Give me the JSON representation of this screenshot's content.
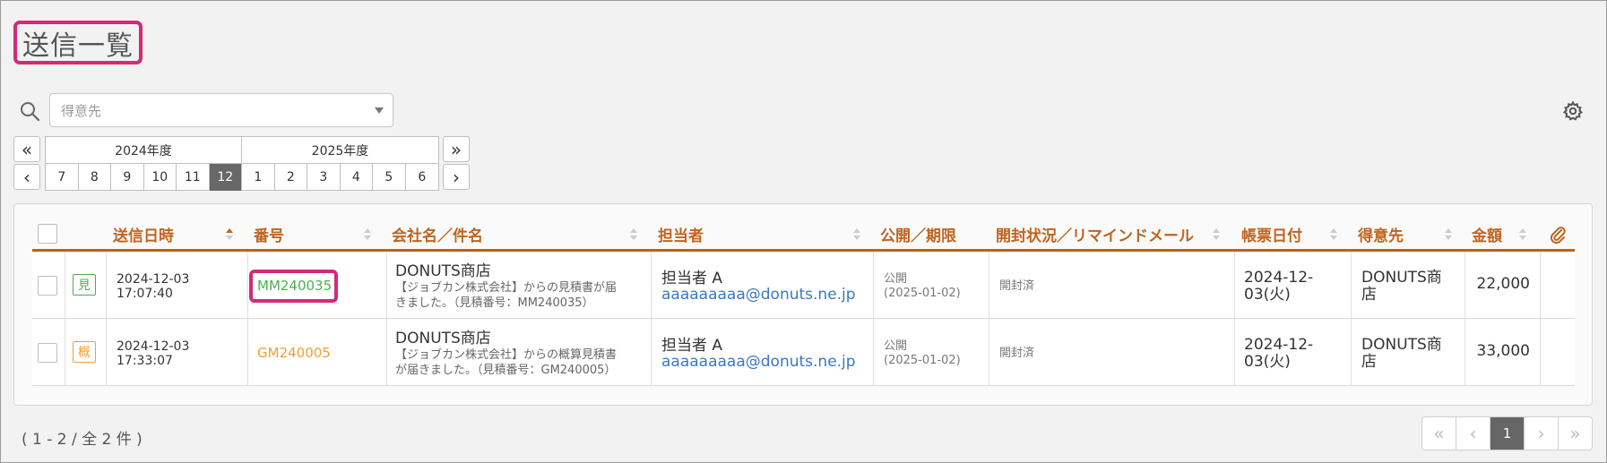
{
  "page_title": "送信一覧",
  "filter": {
    "client_placeholder": "得意先"
  },
  "fiscal_nav": {
    "prev_year": "«",
    "next_year": "»",
    "prev_month": "‹",
    "next_month": "›",
    "years": [
      "2024年度",
      "2025年度"
    ],
    "months": [
      "7",
      "8",
      "9",
      "10",
      "11",
      "12",
      "1",
      "2",
      "3",
      "4",
      "5",
      "6"
    ],
    "active_month": "12"
  },
  "table": {
    "headers": {
      "sent_at": "送信日時",
      "number": "番号",
      "company": "会社名／件名",
      "staff": "担当者",
      "publish": "公開／期限",
      "open_status": "開封状況／リマインドメール",
      "doc_date": "帳票日付",
      "client": "得意先",
      "amount": "金額"
    },
    "rows": [
      {
        "type_badge": "見",
        "sent_date": "2024-12-03",
        "sent_time": "17:07:40",
        "number": "MM240035",
        "company": "DONUTS商店",
        "subject_1": "【ジョブカン株式会社】からの見積書が届",
        "subject_2": "きました。（見積番号：MM240035）",
        "staff": "担当者 A",
        "email": "aaaaaaaaa@donuts.ne.jp",
        "publish": "公開",
        "deadline": "(2025-01-02)",
        "open_status": "開封済",
        "doc_date_1": "2024-12-",
        "doc_date_2": "03(火)",
        "client_1": "DONUTS商",
        "client_2": "店",
        "amount": "22,000"
      },
      {
        "type_badge": "概",
        "sent_date": "2024-12-03",
        "sent_time": "17:33:07",
        "number": "GM240005",
        "company": "DONUTS商店",
        "subject_1": "【ジョブカン株式会社】からの概算見積書",
        "subject_2": "が届きました。（見積番号：GM240005）",
        "staff": "担当者 A",
        "email": "aaaaaaaaa@donuts.ne.jp",
        "publish": "公開",
        "deadline": "(2025-01-02)",
        "open_status": "開封済",
        "doc_date_1": "2024-12-",
        "doc_date_2": "03(火)",
        "client_1": "DONUTS商",
        "client_2": "店",
        "amount": "33,000"
      }
    ]
  },
  "footer": {
    "count_text": "( 1 - 2 / 全 2 件 )",
    "pager": {
      "first": "«",
      "prev": "‹",
      "current": "1",
      "next": "›",
      "last": "»"
    }
  },
  "colors": {
    "highlight": "#d42a78",
    "header_text": "#c0641f",
    "badge_mitsumori": "#4caf50",
    "badge_gaisan": "#f0a030",
    "link_blue": "#3a78c4"
  }
}
